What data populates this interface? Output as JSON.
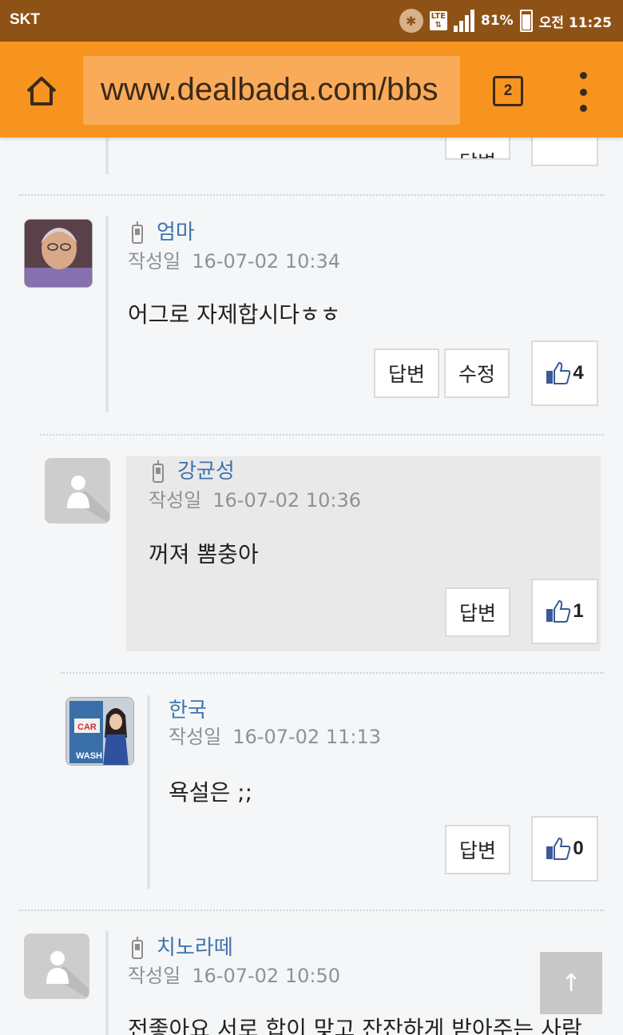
{
  "status_bar": {
    "carrier": "SKT",
    "network": "LTE",
    "battery": "81%",
    "time": "오전 11:25"
  },
  "browser": {
    "url": "www.dealbada.com/bbs",
    "tab_count": "2"
  },
  "comments": [
    {
      "author": "엄마",
      "date_label": "작성일",
      "date": "16-07-02 10:34",
      "text": "어그로 자제합시다ㅎㅎ",
      "reply_label": "답변",
      "edit_label": "수정",
      "likes": "4"
    },
    {
      "author": "강균성",
      "date_label": "작성일",
      "date": "16-07-02 10:36",
      "text": "꺼져 뽐충아",
      "reply_label": "답변",
      "likes": "1"
    },
    {
      "author": "한국",
      "date_label": "작성일",
      "date": "16-07-02 11:13",
      "text": "욕설은 ;;",
      "reply_label": "답변",
      "likes": "0"
    },
    {
      "author": "치노라떼",
      "date_label": "작성일",
      "date": "16-07-02 10:50",
      "text": "전좋아요 서로 합이 맞고 잔잔하게 받아주는 사람"
    }
  ],
  "top_partial": {
    "reply_label": "답변"
  },
  "scroll_top_label": "↑"
}
